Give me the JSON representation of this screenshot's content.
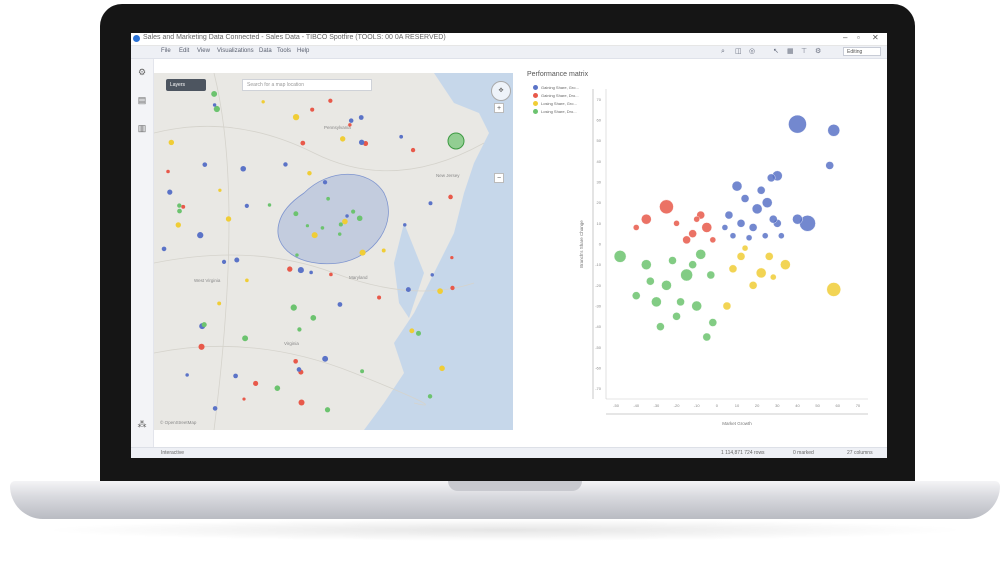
{
  "window": {
    "title": "Sales and Marketing Data Connected - Sales Data - TIBCO Spotfire (TOOLS: 00 0A RESERVED)",
    "min": "–",
    "max": "▫",
    "close": "✕"
  },
  "menu": [
    "File",
    "Edit",
    "View",
    "Visualizations",
    "Data",
    "Tools",
    "Help"
  ],
  "toolbar_mode": "Editing",
  "map": {
    "layer_button": "Layers",
    "search_placeholder": "Search for a map location",
    "labels": [
      {
        "text": "Pennsylvania"
      },
      {
        "text": "Virginia"
      },
      {
        "text": "West Virginia"
      },
      {
        "text": "New Jersey"
      },
      {
        "text": "Maryland"
      }
    ],
    "copyright": "© OpenStreetMap"
  },
  "chart": {
    "title": "Performance matrix",
    "legend": [
      {
        "label": "Gaining Share, Gro...",
        "color": "#5b73c7"
      },
      {
        "label": "Gaining Share, Dro...",
        "color": "#e8594a"
      },
      {
        "label": "Losing Share, Gro...",
        "color": "#f0cd36"
      },
      {
        "label": "Losing Share, Dro...",
        "color": "#6cc36f"
      }
    ],
    "ylabel": "Branch's Share Change",
    "xlabel": "Market Growth"
  },
  "chart_data": {
    "type": "scatter",
    "title": "Performance matrix",
    "xlabel": "Market Growth",
    "ylabel": "Branch's Share Change",
    "x_ticks": [
      "-50",
      "-40",
      "-30",
      "-20",
      "-10",
      "0",
      "10",
      "20",
      "30",
      "40",
      "50",
      "60",
      "70"
    ],
    "y_ticks": [
      "70",
      "60",
      "50",
      "40",
      "30",
      "20",
      "10",
      "0",
      "-10",
      "-20",
      "-30",
      "-40",
      "-50",
      "-60",
      "-70"
    ],
    "xlim": [
      -55,
      75
    ],
    "ylim": [
      -75,
      75
    ],
    "series": [
      {
        "name": "Gaining Share, Gro...",
        "color": "#5b73c7",
        "points": [
          [
            40,
            58,
            9
          ],
          [
            58,
            55,
            6
          ],
          [
            56,
            38,
            4
          ],
          [
            30,
            33,
            5
          ],
          [
            27,
            32,
            4
          ],
          [
            45,
            10,
            8
          ],
          [
            40,
            12,
            5
          ],
          [
            10,
            28,
            5
          ],
          [
            14,
            22,
            4
          ],
          [
            20,
            17,
            5
          ],
          [
            25,
            20,
            5
          ],
          [
            12,
            10,
            4
          ],
          [
            6,
            14,
            4
          ],
          [
            18,
            8,
            4
          ],
          [
            30,
            10,
            4
          ],
          [
            8,
            4,
            3
          ],
          [
            16,
            3,
            3
          ],
          [
            24,
            4,
            3
          ],
          [
            32,
            4,
            3
          ],
          [
            4,
            8,
            3
          ],
          [
            22,
            26,
            4
          ],
          [
            28,
            12,
            4
          ]
        ]
      },
      {
        "name": "Gaining Share, Dro...",
        "color": "#e8594a",
        "points": [
          [
            -25,
            18,
            7
          ],
          [
            -35,
            12,
            5
          ],
          [
            -12,
            5,
            4
          ],
          [
            -5,
            8,
            5
          ],
          [
            -15,
            2,
            4
          ],
          [
            -40,
            8,
            3
          ],
          [
            -8,
            14,
            4
          ],
          [
            -20,
            10,
            3
          ],
          [
            -2,
            2,
            3
          ],
          [
            -10,
            12,
            3
          ]
        ]
      },
      {
        "name": "Losing Share, Gro...",
        "color": "#f0cd36",
        "points": [
          [
            58,
            -22,
            7
          ],
          [
            34,
            -10,
            5
          ],
          [
            22,
            -14,
            5
          ],
          [
            12,
            -6,
            4
          ],
          [
            8,
            -12,
            4
          ],
          [
            18,
            -20,
            4
          ],
          [
            5,
            -30,
            4
          ],
          [
            26,
            -6,
            4
          ],
          [
            14,
            -2,
            3
          ],
          [
            28,
            -16,
            3
          ]
        ]
      },
      {
        "name": "Losing Share, Dro...",
        "color": "#6cc36f",
        "points": [
          [
            -48,
            -6,
            6
          ],
          [
            -35,
            -10,
            5
          ],
          [
            -25,
            -20,
            5
          ],
          [
            -15,
            -15,
            6
          ],
          [
            -8,
            -5,
            5
          ],
          [
            -30,
            -28,
            5
          ],
          [
            -20,
            -35,
            4
          ],
          [
            -10,
            -30,
            5
          ],
          [
            -5,
            -45,
            4
          ],
          [
            -2,
            -38,
            4
          ],
          [
            -40,
            -25,
            4
          ],
          [
            -28,
            -40,
            4
          ],
          [
            -18,
            -28,
            4
          ],
          [
            -12,
            -10,
            4
          ],
          [
            -3,
            -15,
            4
          ],
          [
            -22,
            -8,
            4
          ],
          [
            -33,
            -18,
            4
          ]
        ]
      }
    ]
  },
  "status": {
    "tab": "Interactive",
    "rows": "1 114,871 724 rows",
    "marked": "0 marked",
    "columns": "27 columns"
  }
}
